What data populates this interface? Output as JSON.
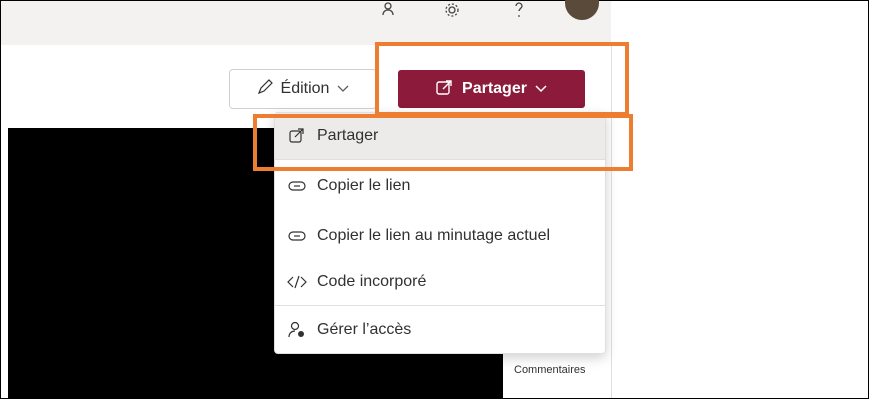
{
  "toolbar": {
    "edit_label": "Édition",
    "share_label": "Partager"
  },
  "menu": {
    "items": [
      {
        "label": "Partager",
        "icon": "share-icon"
      },
      {
        "label": "Copier le lien",
        "icon": "link-icon"
      },
      {
        "label": "Copier le lien au minutage actuel",
        "icon": "link-icon"
      },
      {
        "label": "Code incorporé",
        "icon": "code-icon"
      },
      {
        "label": "Gérer l’accès",
        "icon": "manage-access-icon"
      }
    ]
  },
  "side_panel": {
    "comments_label": "Commentaires"
  },
  "colors": {
    "share_button": "#8c1a3a",
    "highlight": "#ed7d31"
  }
}
